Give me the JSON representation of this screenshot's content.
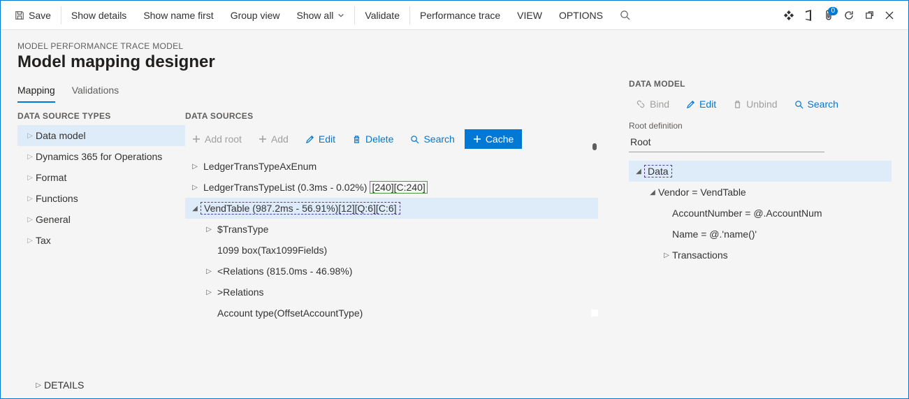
{
  "toolbar": {
    "save": "Save",
    "show_details": "Show details",
    "show_name_first": "Show name first",
    "group_view": "Group view",
    "show_all": "Show all",
    "validate": "Validate",
    "perf_trace": "Performance trace",
    "view": "VIEW",
    "options": "OPTIONS",
    "badge": "0"
  },
  "breadcrumb": "MODEL PERFORMANCE TRACE MODEL",
  "page_title": "Model mapping designer",
  "tabs": {
    "mapping": "Mapping",
    "validations": "Validations"
  },
  "left": {
    "header": "DATA SOURCE TYPES",
    "items": [
      "Data model",
      "Dynamics 365 for Operations",
      "Format",
      "Functions",
      "General",
      "Tax"
    ]
  },
  "mid": {
    "header": "DATA SOURCES",
    "btns": {
      "add_root": "Add root",
      "add": "Add",
      "edit": "Edit",
      "delete": "Delete",
      "search": "Search",
      "cache": "Cache"
    },
    "rows": {
      "r0": "LedgerTransTypeAxEnum",
      "r1_a": "LedgerTransTypeList (0.3ms - 0.02%)",
      "r1_b": "[240][C:240]",
      "r2": "VendTable (987.2ms - 56.91%)[12][Q:6][C:6]",
      "r3": "$TransType",
      "r4": "1099 box(Tax1099Fields)",
      "r5": "<Relations (815.0ms - 46.98%)",
      "r6": ">Relations",
      "r7": "Account type(OffsetAccountType)"
    }
  },
  "right": {
    "header": "DATA MODEL",
    "btns": {
      "bind": "Bind",
      "edit": "Edit",
      "unbind": "Unbind",
      "search": "Search"
    },
    "root_label": "Root definition",
    "root_value": "Root",
    "rows": {
      "r0": "Data",
      "r1": "Vendor = VendTable",
      "r2": "AccountNumber = @.AccountNum",
      "r3": "Name = @.'name()'",
      "r4": "Transactions"
    }
  },
  "details": "DETAILS"
}
